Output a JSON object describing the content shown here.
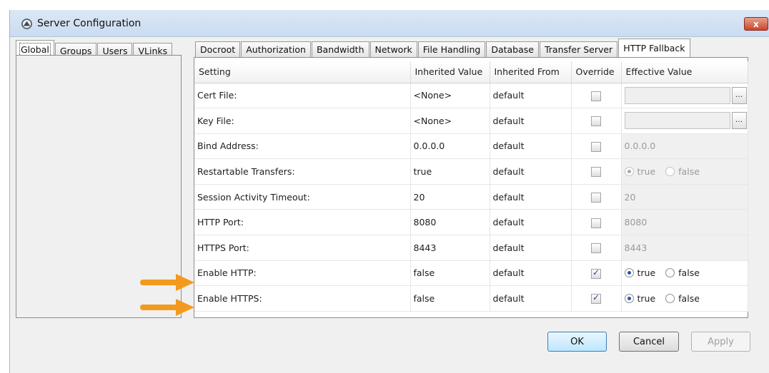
{
  "window": {
    "title": "Server Configuration",
    "close_label": "x"
  },
  "left_tabs": [
    "Global",
    "Groups",
    "Users",
    "VLinks"
  ],
  "right_tabs": [
    "Docroot",
    "Authorization",
    "Bandwidth",
    "Network",
    "File Handling",
    "Database",
    "Transfer Server",
    "HTTP Fallback"
  ],
  "table": {
    "headers": {
      "setting": "Setting",
      "inherited_value": "Inherited Value",
      "inherited_from": "Inherited From",
      "override": "Override",
      "effective_value": "Effective Value"
    },
    "rows": [
      {
        "setting": "Cert File:",
        "inherited_value": "<None>",
        "inherited_from": "default",
        "override": false,
        "effective": "",
        "type": "file"
      },
      {
        "setting": "Key File:",
        "inherited_value": "<None>",
        "inherited_from": "default",
        "override": false,
        "effective": "",
        "type": "file"
      },
      {
        "setting": "Bind Address:",
        "inherited_value": "0.0.0.0",
        "inherited_from": "default",
        "override": false,
        "effective": "0.0.0.0",
        "type": "text"
      },
      {
        "setting": "Restartable Transfers:",
        "inherited_value": "true",
        "inherited_from": "default",
        "override": false,
        "effective": "true",
        "type": "radio"
      },
      {
        "setting": "Session Activity Timeout:",
        "inherited_value": "20",
        "inherited_from": "default",
        "override": false,
        "effective": "20",
        "type": "text"
      },
      {
        "setting": "HTTP Port:",
        "inherited_value": "8080",
        "inherited_from": "default",
        "override": false,
        "effective": "8080",
        "type": "text"
      },
      {
        "setting": "HTTPS Port:",
        "inherited_value": "8443",
        "inherited_from": "default",
        "override": false,
        "effective": "8443",
        "type": "text"
      },
      {
        "setting": "Enable HTTP:",
        "inherited_value": "false",
        "inherited_from": "default",
        "override": true,
        "effective": "true",
        "type": "radio"
      },
      {
        "setting": "Enable HTTPS:",
        "inherited_value": "false",
        "inherited_from": "default",
        "override": true,
        "effective": "true",
        "type": "radio"
      }
    ],
    "radio_labels": {
      "true": "true",
      "false": "false"
    },
    "browse_label": "..."
  },
  "buttons": {
    "ok": "OK",
    "cancel": "Cancel",
    "apply": "Apply"
  },
  "colors": {
    "annotation_arrow": "#f39a1e"
  }
}
